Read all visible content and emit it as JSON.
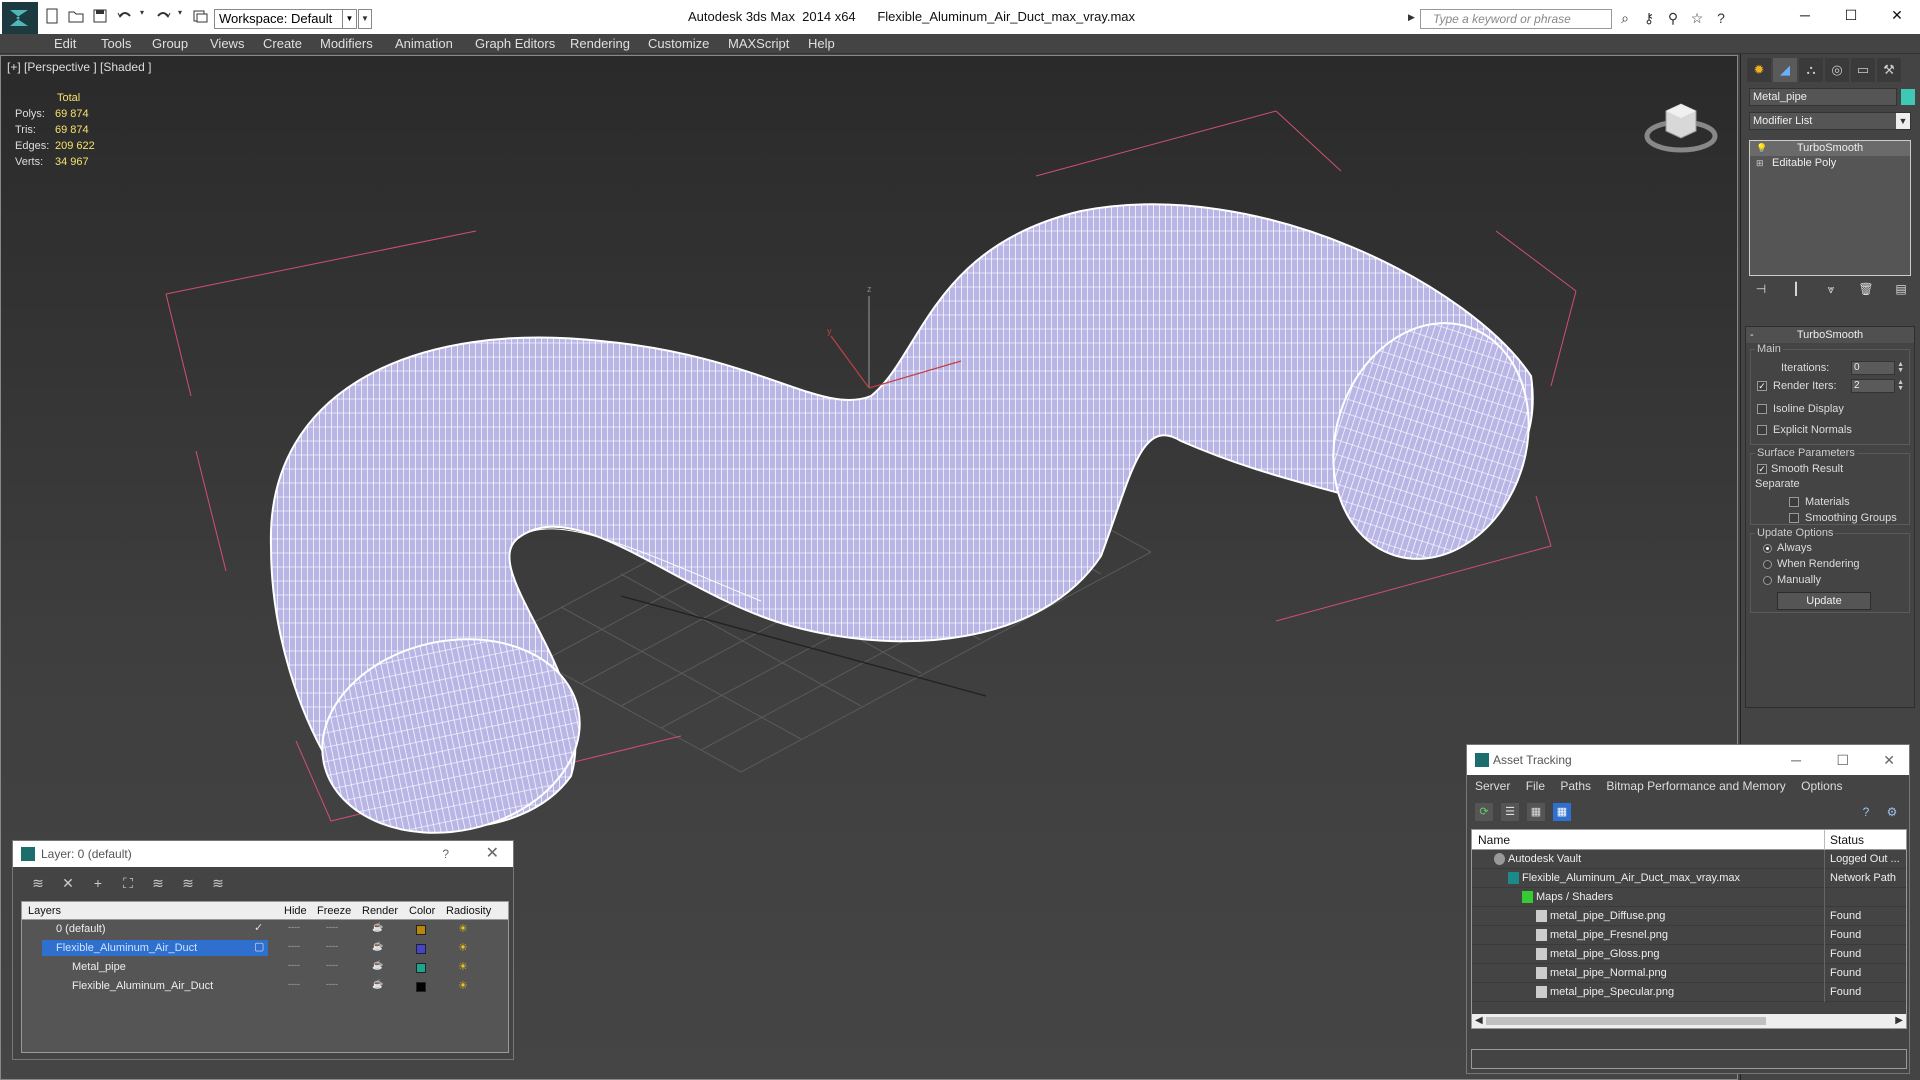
{
  "titlebar": {
    "app_name": "Autodesk 3ds Max  2014 x64",
    "file_name": "Flexible_Aluminum_Air_Duct_max_vray.max",
    "workspace": "Workspace: Default",
    "search_placeholder": "Type a keyword or phrase"
  },
  "menu": [
    "Edit",
    "Tools",
    "Group",
    "Views",
    "Create",
    "Modifiers",
    "Animation",
    "Graph Editors",
    "Rendering",
    "Customize",
    "MAXScript",
    "Help"
  ],
  "viewport": {
    "label": "[+] [Perspective ] [Shaded ]",
    "stats": {
      "header": "Total",
      "polys_label": "Polys:",
      "polys": "69 874",
      "tris_label": "Tris:",
      "tris": "69 874",
      "edges_label": "Edges:",
      "edges": "209 622",
      "verts_label": "Verts:",
      "verts": "34 967"
    },
    "axis_labels": {
      "z": "z",
      "y": "y"
    }
  },
  "command_panel": {
    "object_name": "Metal_pipe",
    "object_color": "#3ec8b6",
    "modifier_list": "Modifier List",
    "stack": [
      "TurboSmooth",
      "Editable Poly"
    ],
    "rollout_title": "TurboSmooth",
    "main_group": "Main",
    "iterations_label": "Iterations:",
    "iterations_value": "0",
    "render_iters_label": "Render Iters:",
    "render_iters_value": "2",
    "isoline_label": "Isoline Display",
    "explicit_label": "Explicit Normals",
    "surface_group": "Surface Parameters",
    "smooth_result_label": "Smooth Result",
    "separate_label": "Separate",
    "materials_label": "Materials",
    "smoothing_groups_label": "Smoothing Groups",
    "update_group": "Update Options",
    "always_label": "Always",
    "when_rendering_label": "When Rendering",
    "manually_label": "Manually",
    "update_button": "Update"
  },
  "layer_dialog": {
    "title": "Layer: 0 (default)",
    "help": "?",
    "columns": {
      "layers": "Layers",
      "hide": "Hide",
      "freeze": "Freeze",
      "render": "Render",
      "color": "Color",
      "radiosity": "Radiosity"
    },
    "rows": [
      {
        "name": "0 (default)",
        "color": "#b8860b"
      },
      {
        "name": "Flexible_Aluminum_Air_Duct",
        "color": "#4444cc"
      },
      {
        "name": "Metal_pipe",
        "color": "#1fa58e"
      },
      {
        "name": "Flexible_Aluminum_Air_Duct",
        "color": "#000000"
      }
    ]
  },
  "asset_tracking": {
    "title": "Asset Tracking",
    "menu": [
      "Server",
      "File",
      "Paths",
      "Bitmap Performance and Memory",
      "Options"
    ],
    "columns": {
      "name": "Name",
      "status": "Status"
    },
    "rows": [
      {
        "name": "Autodesk Vault",
        "status": "Logged Out ..."
      },
      {
        "name": "Flexible_Aluminum_Air_Duct_max_vray.max",
        "status": "Network Path"
      },
      {
        "name": "Maps / Shaders",
        "status": ""
      },
      {
        "name": "metal_pipe_Diffuse.png",
        "status": "Found"
      },
      {
        "name": "metal_pipe_Fresnel.png",
        "status": "Found"
      },
      {
        "name": "metal_pipe_Gloss.png",
        "status": "Found"
      },
      {
        "name": "metal_pipe_Normal.png",
        "status": "Found"
      },
      {
        "name": "metal_pipe_Specular.png",
        "status": "Found"
      }
    ]
  }
}
